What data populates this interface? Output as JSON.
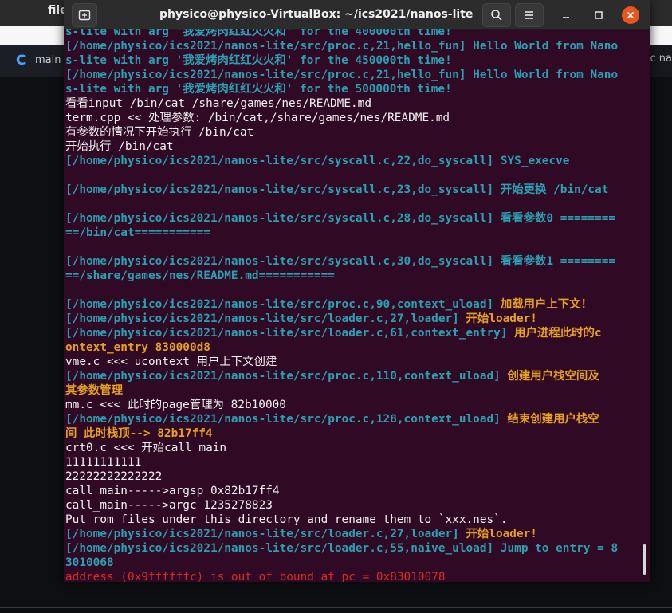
{
  "background_app": {
    "menu_label": "file",
    "tab_label": "main",
    "tab_icon_letter": "C",
    "right_tab_text": "c na"
  },
  "window": {
    "title": "physico@physico-VirtualBox: ~/ics2021/nanos-lite",
    "accent_color": "#e95420"
  },
  "terminal": {
    "lines": [
      {
        "cls": "cyan",
        "text": "s-lite with arg '我爱烤肉红红火火和' for the 400000th time!"
      },
      {
        "cls": "cyan",
        "text": "[/home/physico/ics2021/nanos-lite/src/proc.c,21,hello_fun] Hello World from Nano"
      },
      {
        "cls": "cyan",
        "text": "s-lite with arg '我爱烤肉红红火火和' for the 450000th time!"
      },
      {
        "cls": "cyan",
        "text": "[/home/physico/ics2021/nanos-lite/src/proc.c,21,hello_fun] Hello World from Nano"
      },
      {
        "cls": "cyan",
        "text": "s-lite with arg '我爱烤肉红红火火和' for the 500000th time!"
      },
      {
        "cls": "white",
        "text": "看看input /bin/cat /share/games/nes/README.md"
      },
      {
        "cls": "white",
        "text": "term.cpp << 处理参数: /bin/cat,/share/games/nes/README.md"
      },
      {
        "cls": "white",
        "text": "有参数的情况下开始执行 /bin/cat"
      },
      {
        "cls": "white",
        "text": "开始执行 /bin/cat"
      },
      {
        "cls": "cyan",
        "text": "[/home/physico/ics2021/nanos-lite/src/syscall.c,22,do_syscall] SYS_execve"
      },
      {
        "cls": "cyan",
        "text": ""
      },
      {
        "cls": "cyan",
        "text": "[/home/physico/ics2021/nanos-lite/src/syscall.c,23,do_syscall] 开始更换 /bin/cat"
      },
      {
        "cls": "cyan",
        "text": ""
      },
      {
        "cls": "cyan",
        "text": "[/home/physico/ics2021/nanos-lite/src/syscall.c,28,do_syscall] 看看参数0 ========"
      },
      {
        "cls": "cyan",
        "text": "==/bin/cat==========="
      },
      {
        "cls": "cyan",
        "text": ""
      },
      {
        "cls": "cyan",
        "text": "[/home/physico/ics2021/nanos-lite/src/syscall.c,30,do_syscall] 看看参数1 ========"
      },
      {
        "cls": "cyan",
        "text": "==/share/games/nes/README.md==========="
      },
      {
        "cls": "cyan",
        "text": ""
      },
      {
        "cls": "mixed",
        "a": "[/home/physico/ics2021/nanos-lite/src/proc.c,90,context_uload] ",
        "b": "加载用户上下文！"
      },
      {
        "cls": "mixed",
        "a": "[/home/physico/ics2021/nanos-lite/src/loader.c,27,loader] ",
        "b": "开始loader!"
      },
      {
        "cls": "mixed",
        "a": "[/home/physico/ics2021/nanos-lite/src/loader.c,61,context_entry] ",
        "b": "用户进程此时的c"
      },
      {
        "cls": "yellow",
        "text": "ontext_entry 830000d8"
      },
      {
        "cls": "white",
        "text": "vme.c <<< ucontext 用户上下文创建"
      },
      {
        "cls": "mixed",
        "a": "[/home/physico/ics2021/nanos-lite/src/proc.c,110,context_uload] ",
        "b": "创建用户栈空间及"
      },
      {
        "cls": "yellow",
        "text": "其参数管理"
      },
      {
        "cls": "white",
        "text": "mm.c <<< 此时的page管理为 82b10000"
      },
      {
        "cls": "mixed",
        "a": "[/home/physico/ics2021/nanos-lite/src/proc.c,128,context_uload] ",
        "b": "结束创建用户栈空"
      },
      {
        "cls": "yellow",
        "text": "间 此时栈顶--> 82b17ff4"
      },
      {
        "cls": "white",
        "text": "crt0.c <<< 开始call_main"
      },
      {
        "cls": "white",
        "text": "11111111111"
      },
      {
        "cls": "white",
        "text": "22222222222222"
      },
      {
        "cls": "white",
        "text": "call_main----->argsp 0x82b17ff4"
      },
      {
        "cls": "white",
        "text": "call_main----->argc 1235278823"
      },
      {
        "cls": "white",
        "text": "Put rom files under this directory and rename them to `xxx.nes`."
      },
      {
        "cls": "mixed",
        "a": "[/home/physico/ics2021/nanos-lite/src/loader.c,27,loader] ",
        "b": "开始loader!"
      },
      {
        "cls": "cyan",
        "text": "[/home/physico/ics2021/nanos-lite/src/loader.c,55,naive_uload] Jump to entry = 8"
      },
      {
        "cls": "cyan",
        "text": "3010068"
      },
      {
        "cls": "red",
        "text": "address (0x9ffffffc) is out of bound at pc = 0x83010078"
      }
    ]
  }
}
